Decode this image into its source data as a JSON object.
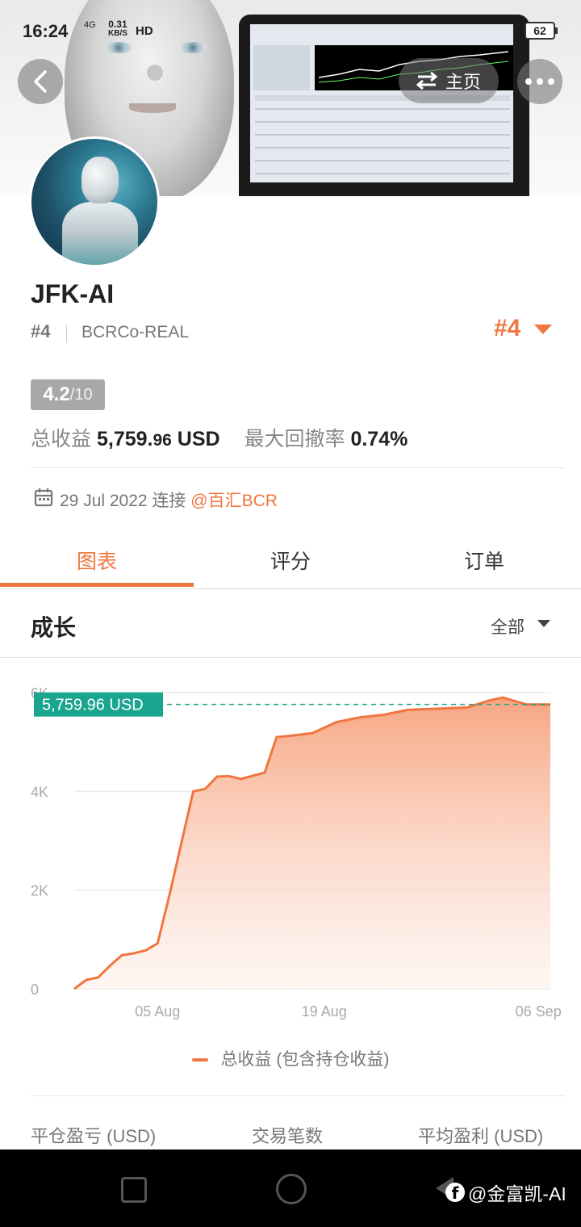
{
  "status_bar": {
    "time": "16:24",
    "network": "4G",
    "speed_value": "0.31",
    "speed_unit": "KB/S",
    "hd": "HD",
    "battery": "62"
  },
  "header": {
    "home_label": "主页",
    "back_icon": "chevron-left-icon",
    "swap_icon": "swap-arrows-icon",
    "more_icon": "more-dots-icon"
  },
  "profile": {
    "name": "JFK-AI",
    "rank_small": "#4",
    "broker": "BCRCo-REAL",
    "rank_big": "#4",
    "score": "4.2",
    "score_max": "/10",
    "total_profit_label": "总收益",
    "total_profit_main": "5,759.",
    "total_profit_cents": "96",
    "total_profit_unit": " USD",
    "drawdown_label": "最大回撤率",
    "drawdown_value": "0.74%",
    "since_date": "29 Jul 2022",
    "since_connect": "连接",
    "since_link": "@百汇BCR"
  },
  "tabs": [
    {
      "label": "图表",
      "active": true
    },
    {
      "label": "评分",
      "active": false
    },
    {
      "label": "订单",
      "active": false
    }
  ],
  "section": {
    "title": "成长",
    "filter": "全部"
  },
  "chart_data": {
    "type": "area",
    "title": "",
    "ylabel": "",
    "xlabel": "",
    "y_ticks": [
      "0",
      "2K",
      "4K",
      "6K"
    ],
    "ylim": [
      0,
      6000
    ],
    "x_ticks": [
      "05 Aug",
      "19 Aug",
      "06 Sep"
    ],
    "xlim": [
      "29 Jul 2022",
      "07 Sep 2022"
    ],
    "current_value_label": "5,759.96 USD",
    "current_value": 5759.96,
    "series": [
      {
        "name": "总收益 (包含持仓收益)",
        "color": "#f07640",
        "x": [
          "2022-07-29",
          "2022-07-30",
          "2022-07-31",
          "2022-08-01",
          "2022-08-02",
          "2022-08-03",
          "2022-08-04",
          "2022-08-05",
          "2022-08-06",
          "2022-08-08",
          "2022-08-09",
          "2022-08-10",
          "2022-08-11",
          "2022-08-12",
          "2022-08-14",
          "2022-08-15",
          "2022-08-16",
          "2022-08-18",
          "2022-08-20",
          "2022-08-22",
          "2022-08-24",
          "2022-08-26",
          "2022-08-29",
          "2022-08-31",
          "2022-09-02",
          "2022-09-03",
          "2022-09-05",
          "2022-09-07"
        ],
        "y": [
          0,
          180,
          230,
          470,
          680,
          720,
          780,
          920,
          1900,
          4000,
          4050,
          4300,
          4310,
          4250,
          4380,
          5100,
          5120,
          5180,
          5400,
          5500,
          5550,
          5650,
          5680,
          5700,
          5850,
          5900,
          5760,
          5760
        ]
      }
    ],
    "grid": true,
    "legend_position": "bottom"
  },
  "bottom_labels": {
    "closed_pnl": "平仓盈亏 (USD)",
    "trade_count": "交易笔数",
    "avg_profit": "平均盈利 (USD)"
  },
  "watermark": {
    "text": "@金富凯-AI",
    "icon": "facebook-icon"
  },
  "colors": {
    "accent": "#f07640",
    "value_label_bg": "#1aa68e",
    "score_badge": "#a8a8a8"
  }
}
